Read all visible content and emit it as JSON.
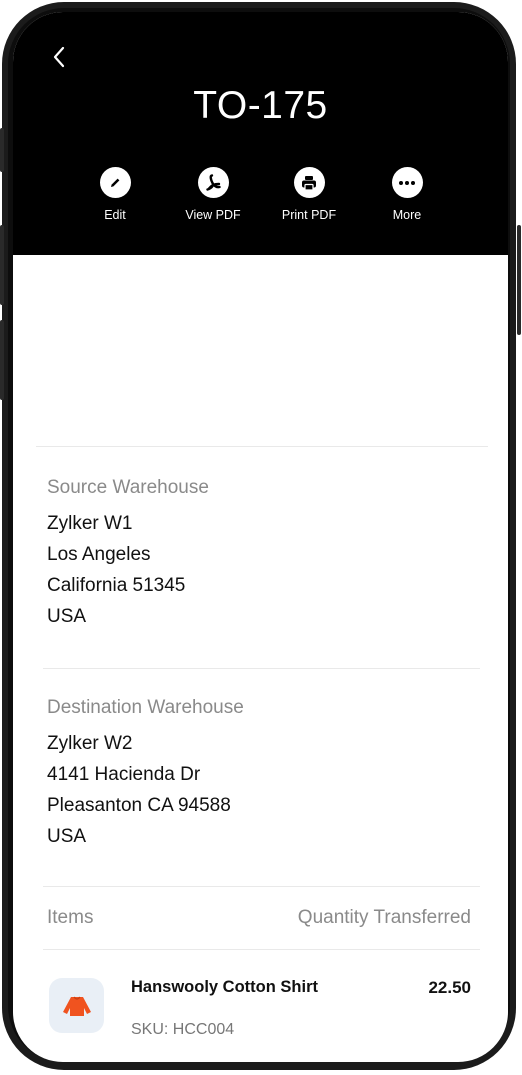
{
  "header": {
    "title": "TO-175",
    "actions": [
      {
        "label": "Edit",
        "icon": "pencil-icon"
      },
      {
        "label": "View PDF",
        "icon": "pdf-icon"
      },
      {
        "label": "Print PDF",
        "icon": "printer-icon"
      },
      {
        "label": "More",
        "icon": "more-icon"
      }
    ]
  },
  "source": {
    "label": "Source Warehouse",
    "lines": [
      "Zylker W1",
      "Los Angeles",
      "California 51345",
      "USA"
    ]
  },
  "destination": {
    "label": "Destination Warehouse",
    "lines": [
      "Zylker W2",
      "4141 Hacienda Dr",
      "Pleasanton CA 94588",
      "USA"
    ]
  },
  "items_header": {
    "left": "Items",
    "right": "Quantity Transferred"
  },
  "items": [
    {
      "name": "Hanswooly Cotton Shirt",
      "sku": "SKU: HCC004",
      "quantity": "22.50",
      "icon": "shirt-icon"
    }
  ],
  "colors": {
    "header_bg": "#000000",
    "shirt": "#f0531f",
    "thumb_bg": "#e9eff6",
    "muted_text": "#8a8a8a"
  }
}
